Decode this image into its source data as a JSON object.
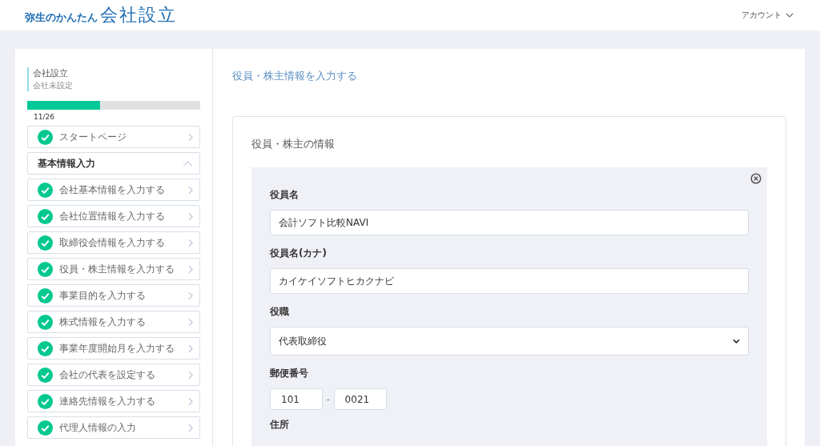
{
  "header": {
    "logo_small": "弥生のかんたん",
    "logo_large": "会社設立",
    "account": "アカウント"
  },
  "sidebar": {
    "title": "会社設立",
    "subtitle": "会社未設定",
    "progress": {
      "level": 0.42,
      "reading": "11/26"
    },
    "items": [
      {
        "kind": "step",
        "label": "スタートページ",
        "checked": true
      },
      {
        "kind": "group",
        "label": "基本情報入力",
        "expanded": true
      },
      {
        "kind": "step",
        "label": "会社基本情報を入力する",
        "checked": true
      },
      {
        "kind": "step",
        "label": "会社位置情報を入力する",
        "checked": true
      },
      {
        "kind": "step",
        "label": "取締役会情報を入力する",
        "checked": true
      },
      {
        "kind": "step",
        "label": "役員・株主情報を入力する",
        "checked": true
      },
      {
        "kind": "step",
        "label": "事業目的を入力する",
        "checked": true
      },
      {
        "kind": "step",
        "label": "株式情報を入力する",
        "checked": true
      },
      {
        "kind": "step",
        "label": "事業年度開始月を入力する",
        "checked": true
      },
      {
        "kind": "step",
        "label": "会社の代表を設定する",
        "checked": true
      },
      {
        "kind": "step",
        "label": "連絡先情報を入力する",
        "checked": true
      },
      {
        "kind": "step",
        "label": "代理人情報の入力",
        "checked": true
      }
    ]
  },
  "main": {
    "title": "役員・株主情報を入力する",
    "panel_title": "役員・株主の情報",
    "fields": [
      {
        "kind": "text",
        "label": "役員名",
        "value": "会計ソフト比較NAVI"
      },
      {
        "kind": "text",
        "label": "役員名(カナ)",
        "value": "カイケイソフトヒカクナビ"
      },
      {
        "kind": "select",
        "label": "役職",
        "value": "代表取締役"
      },
      {
        "kind": "postal",
        "label": "郵便番号",
        "value_1": "101",
        "separator": "-",
        "value_2": "0021"
      },
      {
        "kind": "label",
        "label": "住所"
      }
    ]
  }
}
